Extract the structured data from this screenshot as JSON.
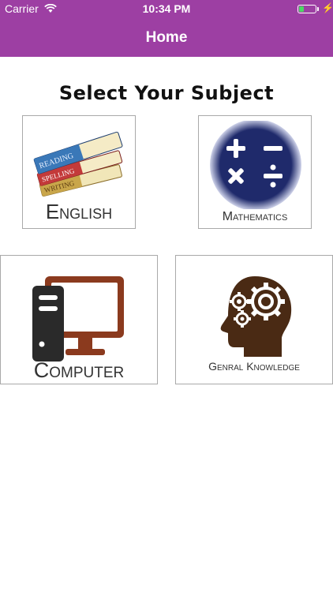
{
  "status_bar": {
    "carrier": "Carrier",
    "time": "10:34 PM",
    "bolt": "⚡",
    "battery_level": 0.3
  },
  "nav": {
    "title": "Home"
  },
  "page": {
    "heading": "Select Your Subject"
  },
  "subjects": [
    {
      "label": "English",
      "icon": "books-icon",
      "book_spines": [
        "READING",
        "SPELLING",
        "WRITING"
      ]
    },
    {
      "label": "Mathematics",
      "icon": "math-operators-icon"
    },
    {
      "label": "Computer",
      "icon": "desktop-computer-icon"
    },
    {
      "label": "Genral Knowledge",
      "icon": "head-gears-icon"
    }
  ],
  "colors": {
    "header_bg": "#9d3fa3",
    "math_circle": "#1f2a6b",
    "computer_tower": "#2a2a2a",
    "computer_monitor": "#8b3a1e",
    "gk_head": "#4a2a14"
  }
}
